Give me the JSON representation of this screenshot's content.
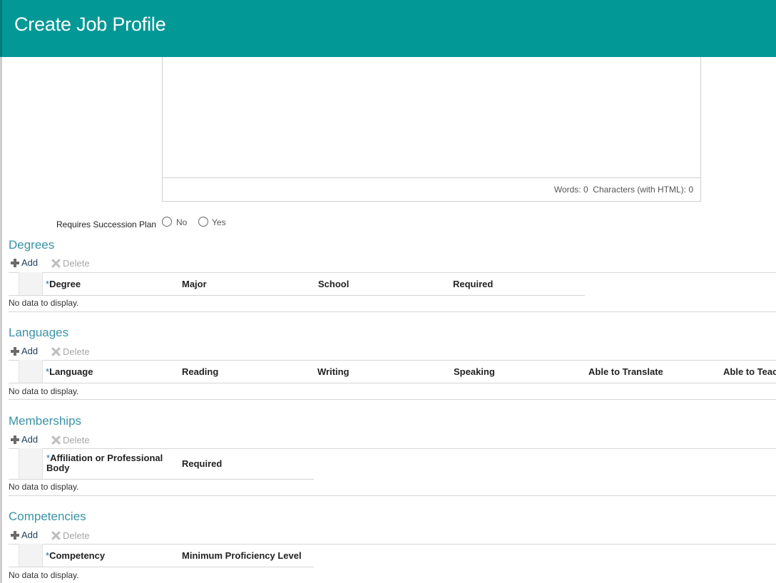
{
  "header": {
    "title": "Create Job Profile"
  },
  "editor": {
    "status": "Words: 0  Characters (with HTML): 0"
  },
  "succession": {
    "label": "Requires Succession Plan",
    "options": [
      "No",
      "Yes"
    ]
  },
  "toolbar": {
    "add_label": "Add",
    "delete_label": "Delete"
  },
  "empty_text": "No data to display.",
  "sections": {
    "degrees": {
      "title": "Degrees",
      "columns": [
        "Degree",
        "Major",
        "School",
        "Required"
      ]
    },
    "languages": {
      "title": "Languages",
      "columns": [
        "Language",
        "Reading",
        "Writing",
        "Speaking",
        "Able to Translate",
        "Able to Teac"
      ]
    },
    "memberships": {
      "title": "Memberships",
      "columns": [
        "Affiliation or Professional Body",
        "Required"
      ]
    },
    "competencies": {
      "title": "Competencies",
      "columns": [
        "Competency",
        "Minimum Proficiency Level"
      ]
    }
  },
  "colors": {
    "header_bg": "#029896",
    "section_title": "#3a93a5",
    "required_marker": "#1a6fa8"
  }
}
